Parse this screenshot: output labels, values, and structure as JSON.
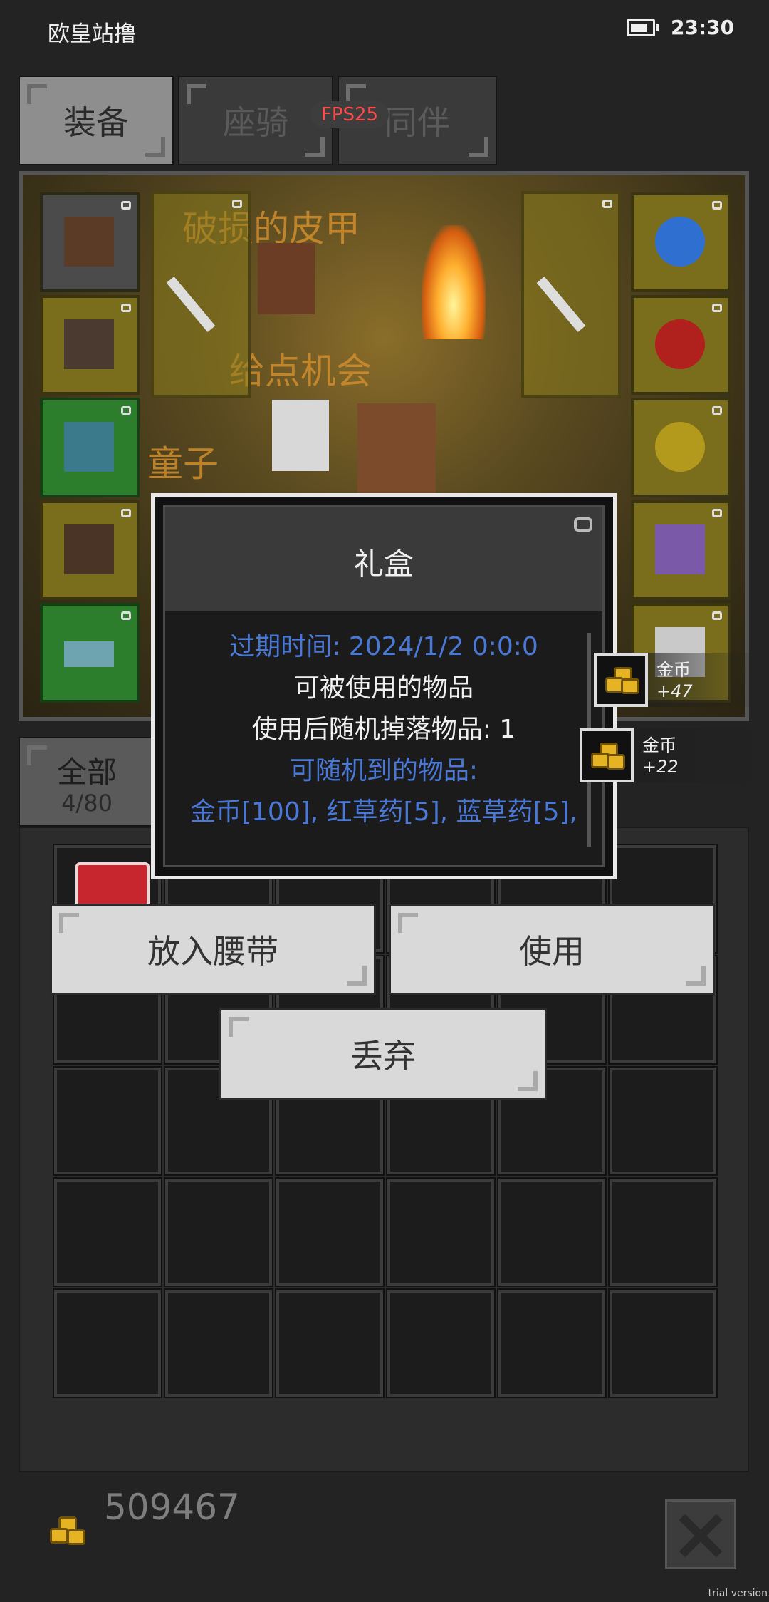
{
  "status_bar": {
    "app_title": "欧皇站撸",
    "time": "23:30"
  },
  "tabs": [
    {
      "label": "装备",
      "active": true
    },
    {
      "label": "座骑",
      "active": false
    },
    {
      "label": "同伴",
      "active": false
    }
  ],
  "fps_badge": "FPS25",
  "scene": {
    "text_1": "破损的皮甲",
    "text_2": "给点机会",
    "text_3": "童子"
  },
  "filter": {
    "label": "全部",
    "count": "4/80"
  },
  "popup": {
    "title": "礼盒",
    "expire": "过期时间: 2024/1/2 0:0:0",
    "usable": "可被使用的物品",
    "drop": "使用后随机掉落物品: 1",
    "possible_label": "可随机到的物品:",
    "possible_items": "金币[100], 红草药[5], 蓝草药[5],"
  },
  "toasts": [
    {
      "name": "金币",
      "amount": "+47"
    },
    {
      "name": "金币",
      "amount": "+22"
    }
  ],
  "actions": {
    "belt": "放入腰带",
    "use": "使用",
    "discard": "丢弃"
  },
  "gold": "509467",
  "watermark": "trial version",
  "colors": {
    "info_blue": "#4a78d6",
    "fps_red": "#ff4b4b",
    "slot_green": "#2c7d2c",
    "slot_yellow": "#7a6e1c"
  }
}
